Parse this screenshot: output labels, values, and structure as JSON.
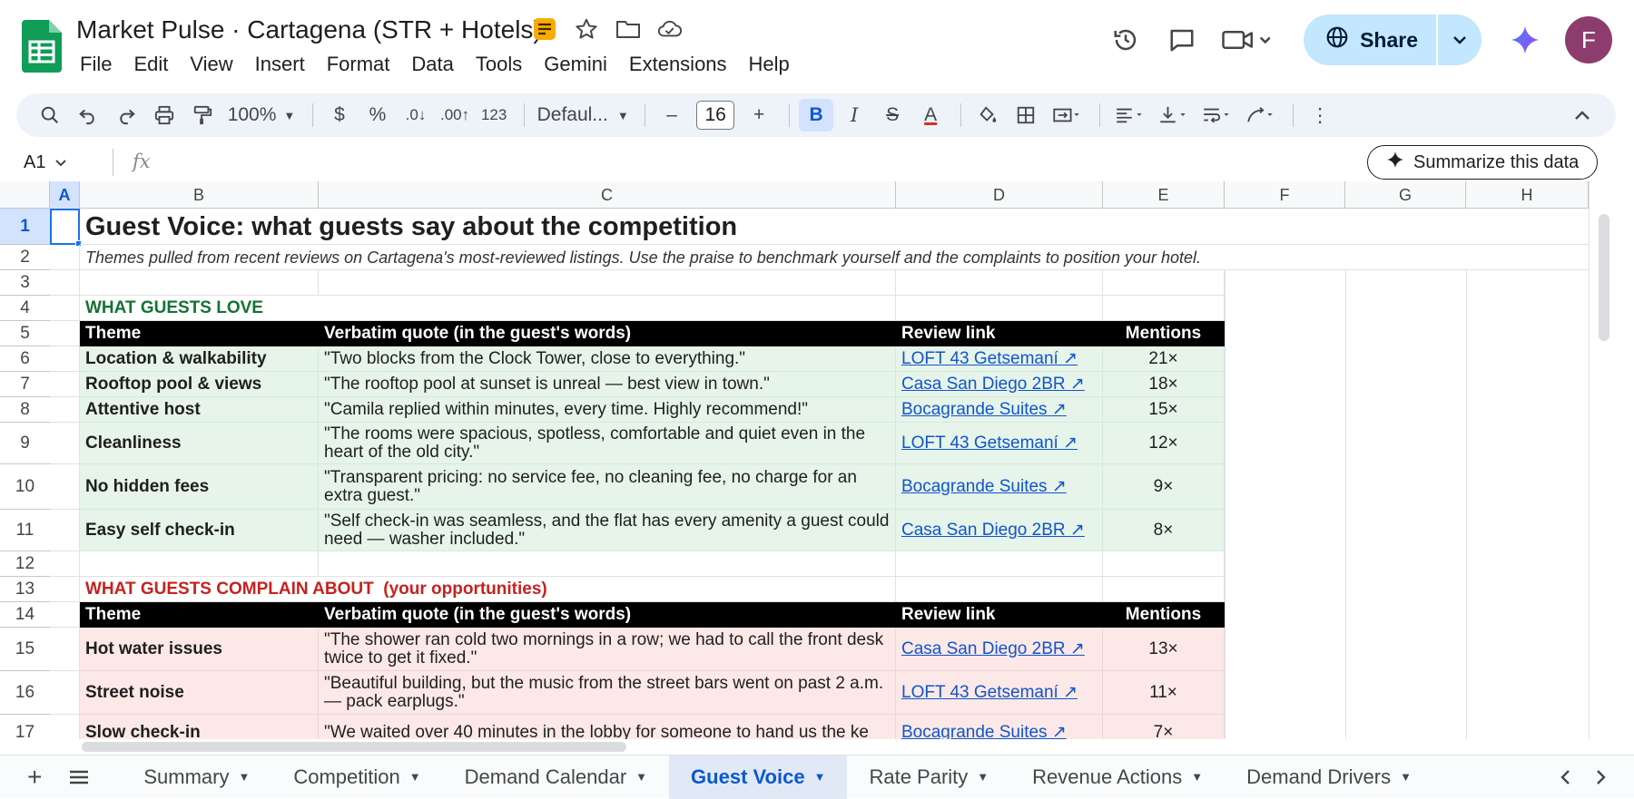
{
  "doc": {
    "title": "Market Pulse · Cartagena (STR + Hotels)"
  },
  "menu": [
    "File",
    "Edit",
    "View",
    "Insert",
    "Format",
    "Data",
    "Tools",
    "Gemini",
    "Extensions",
    "Help"
  ],
  "share_label": "Share",
  "avatar_initial": "F",
  "toolbar": {
    "zoom": "100%",
    "currency": "$",
    "percent": "%",
    "dec_decrease": ".0↓",
    "dec_increase": ".00↑",
    "number_format": "123",
    "font": "Defaul...",
    "font_size": "16",
    "bold": "B",
    "italic": "I",
    "strike": "S",
    "text_color": "A"
  },
  "namebox": "A1",
  "fx": "fx",
  "summarize_label": "Summarize this data",
  "columns": [
    "A",
    "B",
    "C",
    "D",
    "E",
    "F",
    "G",
    "H"
  ],
  "rows": [
    "1",
    "2",
    "3",
    "4",
    "5",
    "6",
    "7",
    "8",
    "9",
    "10",
    "11",
    "12",
    "13",
    "14",
    "15",
    "16",
    "17"
  ],
  "sheet": {
    "title": "Guest Voice: what guests say about the competition",
    "subtitle": "Themes pulled from recent reviews on Cartagena's most-reviewed listings. Use the praise to benchmark yourself and the complaints to position your hotel.",
    "love_heading": "WHAT GUESTS LOVE",
    "complain_heading": "WHAT GUESTS COMPLAIN ABOUT  (your opportunities)",
    "headers": [
      "Theme",
      "Verbatim quote (in the guest's words)",
      "Review link",
      "Mentions"
    ],
    "love": [
      {
        "theme": "Location & walkability",
        "quote": "\"Two blocks from the Clock Tower, close to everything.\"",
        "link": "LOFT 43 Getsemaní ↗",
        "mentions": "21×"
      },
      {
        "theme": "Rooftop pool & views",
        "quote": "\"The rooftop pool at sunset is unreal — best view in town.\"",
        "link": "Casa San Diego 2BR ↗",
        "mentions": "18×"
      },
      {
        "theme": "Attentive host",
        "quote": "\"Camila replied within minutes, every time. Highly recommend!\"",
        "link": "Bocagrande Suites ↗",
        "mentions": "15×"
      },
      {
        "theme": "Cleanliness",
        "quote": "\"The rooms were spacious, spotless, comfortable and quiet even in the heart of the old city.\"",
        "link": "LOFT 43 Getsemaní ↗",
        "mentions": "12×"
      },
      {
        "theme": "No hidden fees",
        "quote": "\"Transparent pricing: no service fee, no cleaning fee, no charge for an extra guest.\"",
        "link": "Bocagrande Suites ↗",
        "mentions": "9×"
      },
      {
        "theme": "Easy self check-in",
        "quote": "\"Self check-in was seamless, and the flat has every amenity a guest could need — washer included.\"",
        "link": "Casa San Diego 2BR ↗",
        "mentions": "8×"
      }
    ],
    "complain": [
      {
        "theme": "Hot water issues",
        "quote": "\"The shower ran cold two mornings in a row; we had to call the front desk twice to get it fixed.\"",
        "link": "Casa San Diego 2BR ↗",
        "mentions": "13×"
      },
      {
        "theme": "Street noise",
        "quote": "\"Beautiful building, but the music from the street bars went on past 2 a.m. — pack earplugs.\"",
        "link": "LOFT 43 Getsemaní ↗",
        "mentions": "11×"
      },
      {
        "theme": "Slow check-in",
        "quote": "\"We waited over 40 minutes in the lobby for someone to hand us the ke",
        "link": "Bocagrande Suites ↗",
        "mentions": "7×"
      }
    ]
  },
  "tabs": [
    "Summary",
    "Competition",
    "Demand Calendar",
    "Guest Voice",
    "Rate Parity",
    "Revenue Actions",
    "Demand Drivers"
  ],
  "active_tab": "Guest Voice",
  "colors": {
    "accent": "#0b57d0",
    "share_bg": "#c2e7ff",
    "love_heading": "#137333",
    "complain_heading": "#c5221f",
    "love_bg": "#e6f4ea",
    "complain_bg": "#fce8e6"
  }
}
